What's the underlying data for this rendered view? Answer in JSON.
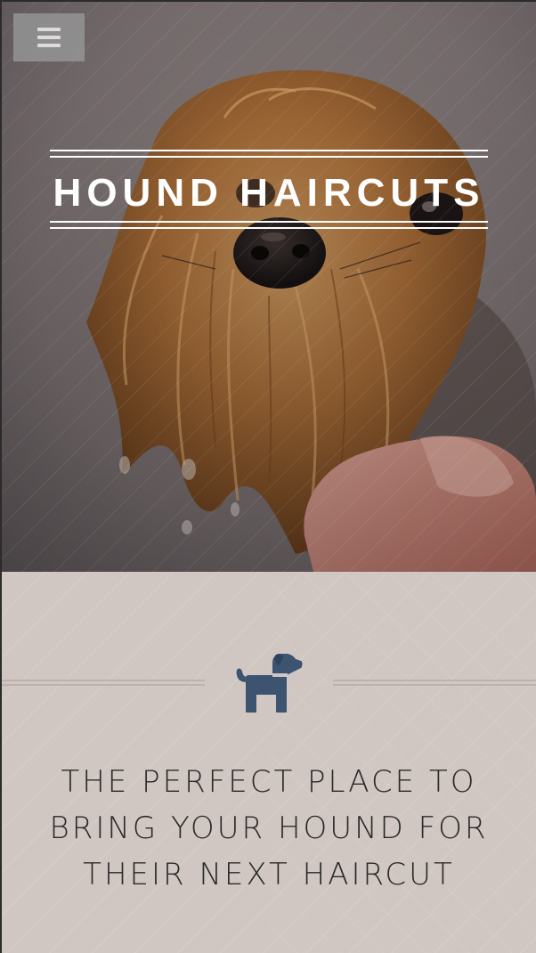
{
  "header": {
    "menu_icon": "hamburger-icon",
    "site_title": "HOUND HAIRCUTS"
  },
  "hero": {
    "image_subject": "wet small dog being groomed"
  },
  "intro": {
    "icon": "dog-icon",
    "tagline_lines": [
      "THE PERFECT PLACE TO",
      "BRING YOUR HOUND FOR",
      "THEIR NEXT HAIRCUT"
    ]
  },
  "colors": {
    "intro_background": "#d1c7c2",
    "icon_color": "#3d5470",
    "title_color": "#ffffff",
    "menu_button_background": "#969696"
  }
}
